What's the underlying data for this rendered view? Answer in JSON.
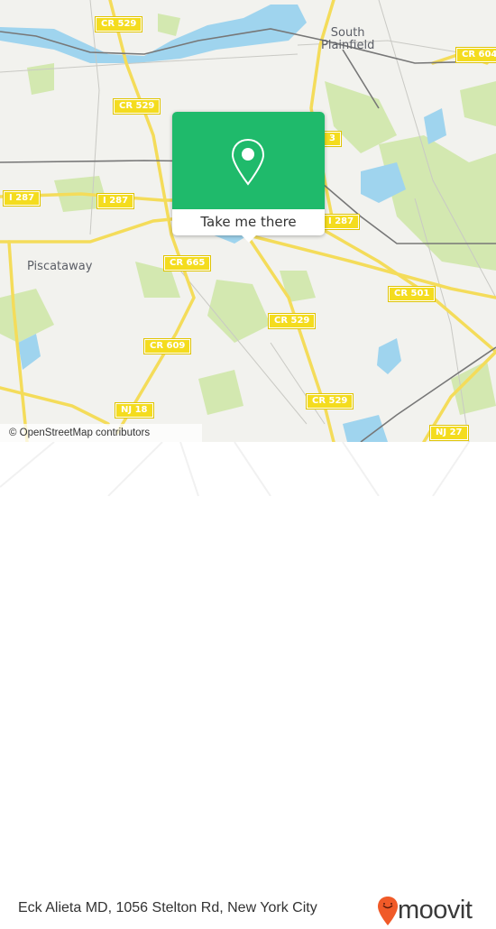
{
  "map": {
    "attribution": "© OpenStreetMap contributors",
    "place_labels": {
      "south_plainfield": [
        "South",
        "Plainfield"
      ],
      "piscataway": "Piscataway"
    },
    "road_shields": [
      {
        "id": "cr529-top",
        "label": "CR 529"
      },
      {
        "id": "cr529-mid",
        "label": "CR 529"
      },
      {
        "id": "cr604",
        "label": "CR 604"
      },
      {
        "id": "cr-partial",
        "label": "3"
      },
      {
        "id": "i287-left",
        "label": "I 287"
      },
      {
        "id": "i287-mid",
        "label": "I 287"
      },
      {
        "id": "i287-right",
        "label": "I 287"
      },
      {
        "id": "cr665",
        "label": "CR 665"
      },
      {
        "id": "cr501",
        "label": "CR 501"
      },
      {
        "id": "cr529-south",
        "label": "CR 529"
      },
      {
        "id": "cr609",
        "label": "CR 609"
      },
      {
        "id": "cr529-se",
        "label": "CR 529"
      },
      {
        "id": "nj18-a",
        "label": "NJ 18"
      },
      {
        "id": "nj18-b",
        "label": "NJ 18"
      },
      {
        "id": "nj27",
        "label": "NJ 27"
      }
    ],
    "colors": {
      "land": "#f2f2ee",
      "park": "#cfe6a8",
      "water": "#9fd4ee",
      "road": "#f4dc5a",
      "rail": "#777777"
    }
  },
  "popup": {
    "icon": "location-pin-icon",
    "button_label": "Take me there",
    "accent": "#1fba6b"
  },
  "footer": {
    "address": "Eck Alieta MD, 1056 Stelton Rd, New York City",
    "brand": "moovit",
    "brand_color": "#f05a28"
  }
}
